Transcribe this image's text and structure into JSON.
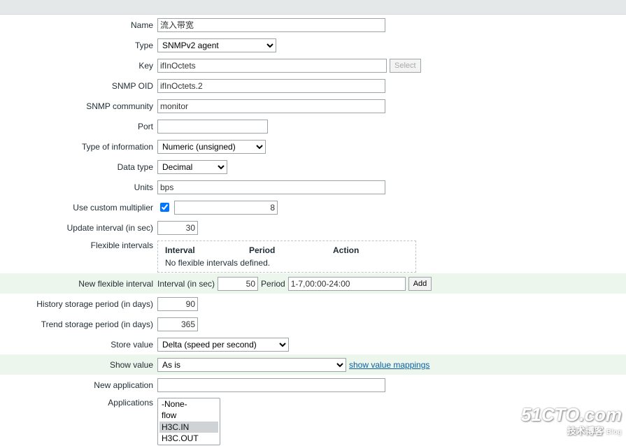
{
  "labels": {
    "name": "Name",
    "type": "Type",
    "key": "Key",
    "snmp_oid": "SNMP OID",
    "snmp_community": "SNMP community",
    "port": "Port",
    "type_info": "Type of information",
    "data_type": "Data type",
    "units": "Units",
    "multiplier": "Use custom multiplier",
    "update_interval": "Update interval (in sec)",
    "flex_intervals": "Flexible intervals",
    "new_flex": "New flexible interval",
    "history": "History storage period (in days)",
    "trend": "Trend storage period (in days)",
    "store_value": "Store value",
    "show_value": "Show value",
    "new_application": "New application",
    "applications": "Applications"
  },
  "fields": {
    "name": "流入带宽",
    "type": "SNMPv2 agent",
    "key": "ifInOctets",
    "snmp_oid": "ifInOctets.2",
    "snmp_community": "monitor",
    "port": "",
    "type_info": "Numeric (unsigned)",
    "data_type": "Decimal",
    "units": "bps",
    "multiplier": "8",
    "update_interval": "30",
    "history": "90",
    "trend": "365",
    "store_value": "Delta (speed per second)",
    "show_value": "As is",
    "new_application": ""
  },
  "flex_table": {
    "h_interval": "Interval",
    "h_period": "Period",
    "h_action": "Action",
    "empty": "No flexible intervals defined."
  },
  "new_flex": {
    "interval_lbl": "Interval (in sec)",
    "interval": "50",
    "period_lbl": "Period",
    "period": "1-7,00:00-24:00"
  },
  "buttons": {
    "select": "Select",
    "add": "Add"
  },
  "links": {
    "show_mappings": "show value mappings"
  },
  "applications": [
    "-None-",
    "flow",
    "H3C.IN",
    "H3C.OUT"
  ],
  "watermark": {
    "domain": "51CTO.com",
    "sub": "技术博客",
    "blog": "Blog"
  }
}
